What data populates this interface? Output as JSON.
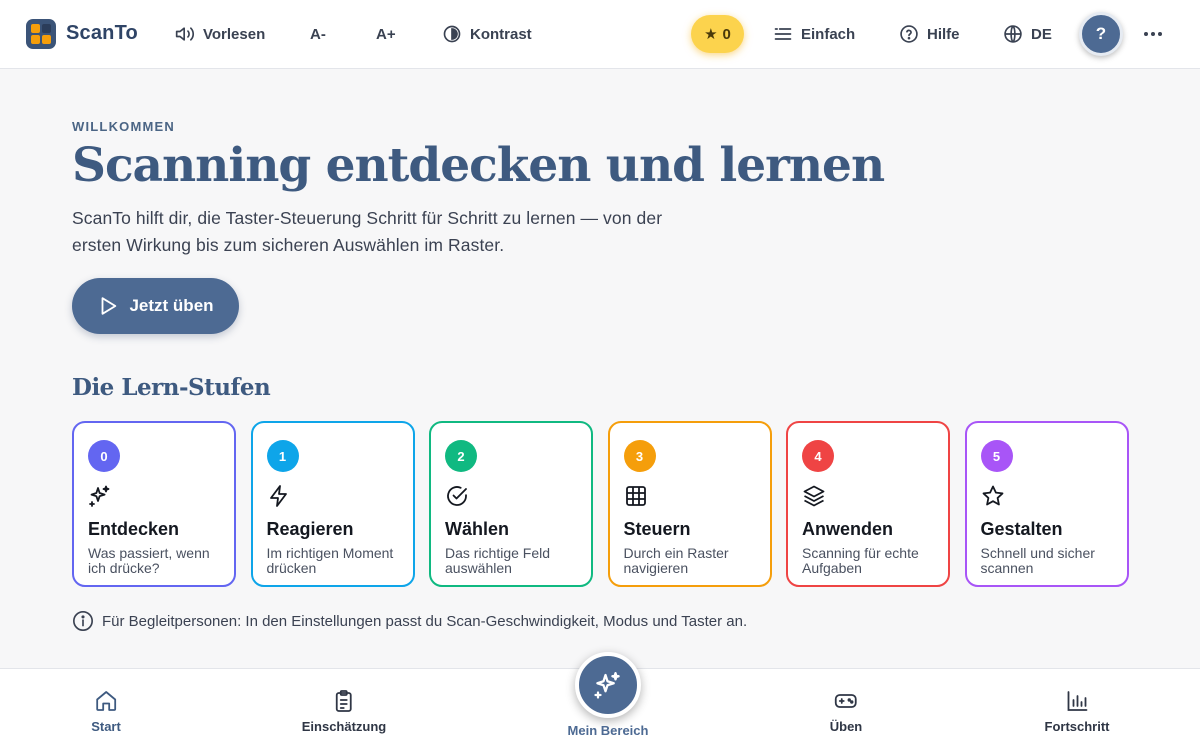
{
  "header": {
    "brand": "ScanTo",
    "read_aloud": "Vorlesen",
    "font_smaller": "A-",
    "font_larger": "A+",
    "contrast": "Kontrast",
    "stars": "0",
    "mode": "Einfach",
    "help": "Hilfe",
    "language": "DE",
    "avatar": "?"
  },
  "hero": {
    "eyebrow": "WILLKOMMEN",
    "title": "Scanning entdecken und lernen",
    "intro": "ScanTo hilft dir, die Taster-Steuerung Schritt für Schritt zu lernen — von der ersten Wirkung bis zum sicheren Auswählen im Raster.",
    "cta": "Jetzt üben"
  },
  "levels": {
    "heading": "Die Lern-Stufen",
    "items": [
      {
        "num": "0",
        "name": "Entdecken",
        "desc": "Was passiert, wenn ich drücke?",
        "color": "#6366f1",
        "icon": "sparkles-icon"
      },
      {
        "num": "1",
        "name": "Reagieren",
        "desc": "Im richtigen Moment drücken",
        "color": "#0ea5e9",
        "icon": "lightning-icon"
      },
      {
        "num": "2",
        "name": "Wählen",
        "desc": "Das richtige Feld auswählen",
        "color": "#10b981",
        "icon": "check-circle-icon"
      },
      {
        "num": "3",
        "name": "Steuern",
        "desc": "Durch ein Raster navigieren",
        "color": "#f59e0b",
        "icon": "grid-icon"
      },
      {
        "num": "4",
        "name": "Anwenden",
        "desc": "Scanning für echte Aufgaben",
        "color": "#ef4444",
        "icon": "layers-icon"
      },
      {
        "num": "5",
        "name": "Gestalten",
        "desc": "Schnell und sicher scannen",
        "color": "#a855f7",
        "icon": "star-icon"
      }
    ]
  },
  "note": "Für Begleitpersonen: In den Einstellungen passt du Scan-Geschwindigkeit, Modus und Taster an.",
  "bottom_nav": {
    "start": "Start",
    "assessment": "Einschätzung",
    "my_area": "Mein Bereich",
    "practice": "Üben",
    "progress": "Fortschritt"
  }
}
